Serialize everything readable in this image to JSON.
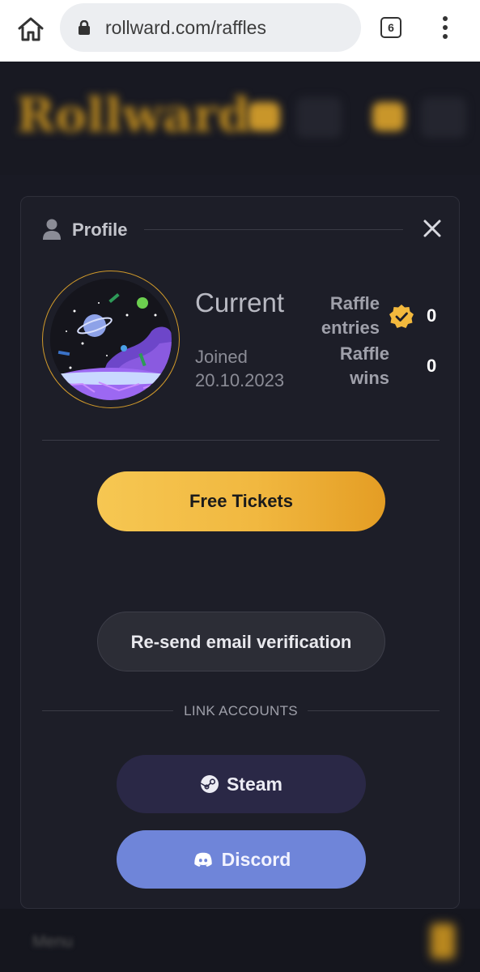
{
  "browser": {
    "url": "rollward.com/raffles",
    "tab_count": "6"
  },
  "site": {
    "logo_text": "Rollward",
    "footer_blur_text": "Menu"
  },
  "modal": {
    "title": "Profile",
    "user": {
      "name": "Current",
      "joined_label": "Joined",
      "joined_date": "20.10.2023"
    },
    "stats": {
      "entries_label": "Raffle entries",
      "entries_value": "0",
      "wins_label": "Raffle wins",
      "wins_value": "0"
    },
    "free_tickets_label": "Free Tickets",
    "resend_label": "Re-send email verification",
    "link_accounts_label": "LINK ACCOUNTS",
    "steam_label": "Steam",
    "discord_label": "Discord"
  },
  "colors": {
    "accent_gold": "#f1b840",
    "discord": "#6f85d9",
    "steam_bg": "#2a2846",
    "modal_bg": "#1d1e28"
  }
}
